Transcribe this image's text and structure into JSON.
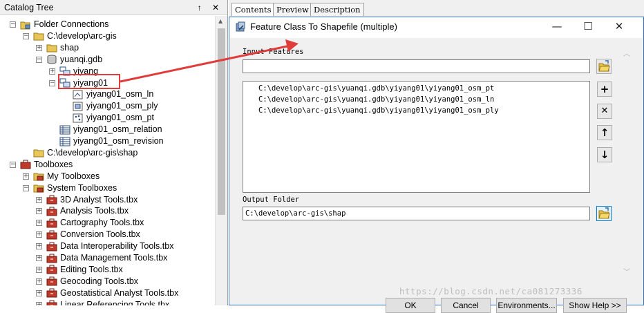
{
  "catalog": {
    "title": "Catalog Tree",
    "title_buttons": "↑ ✕",
    "tree": [
      {
        "label": "Folder Connections",
        "depth": 0,
        "exp": "−",
        "icon": "folder-connection-icon"
      },
      {
        "label": "C:\\develop\\arc-gis",
        "depth": 1,
        "exp": "−",
        "icon": "folder-icon"
      },
      {
        "label": "shap",
        "depth": 2,
        "exp": "+",
        "icon": "folder-icon"
      },
      {
        "label": "yuanqi.gdb",
        "depth": 2,
        "exp": "−",
        "icon": "geodatabase-icon"
      },
      {
        "label": "yiyang",
        "depth": 3,
        "exp": "+",
        "icon": "feature-dataset-icon"
      },
      {
        "label": "yiyang01",
        "depth": 3,
        "exp": "−",
        "icon": "feature-dataset-icon"
      },
      {
        "label": "yiyang01_osm_ln",
        "depth": 4,
        "exp": "",
        "icon": "line-feature-class-icon"
      },
      {
        "label": "yiyang01_osm_ply",
        "depth": 4,
        "exp": "",
        "icon": "polygon-feature-class-icon"
      },
      {
        "label": "yiyang01_osm_pt",
        "depth": 4,
        "exp": "",
        "icon": "point-feature-class-icon"
      },
      {
        "label": "yiyang01_osm_relation",
        "depth": 3,
        "exp": "",
        "icon": "table-icon"
      },
      {
        "label": "yiyang01_osm_revision",
        "depth": 3,
        "exp": "",
        "icon": "table-icon"
      },
      {
        "label": "C:\\develop\\arc-gis\\shap",
        "depth": 1,
        "exp": "",
        "icon": "folder-icon"
      },
      {
        "label": "Toolboxes",
        "depth": 0,
        "exp": "−",
        "icon": "toolboxes-icon"
      },
      {
        "label": "My Toolboxes",
        "depth": 1,
        "exp": "+",
        "icon": "toolbox-folder-icon"
      },
      {
        "label": "System Toolboxes",
        "depth": 1,
        "exp": "−",
        "icon": "toolbox-folder-icon"
      },
      {
        "label": "3D Analyst Tools.tbx",
        "depth": 2,
        "exp": "+",
        "icon": "toolbox-icon"
      },
      {
        "label": "Analysis Tools.tbx",
        "depth": 2,
        "exp": "+",
        "icon": "toolbox-icon"
      },
      {
        "label": "Cartography Tools.tbx",
        "depth": 2,
        "exp": "+",
        "icon": "toolbox-icon"
      },
      {
        "label": "Conversion Tools.tbx",
        "depth": 2,
        "exp": "+",
        "icon": "toolbox-icon"
      },
      {
        "label": "Data Interoperability Tools.tbx",
        "depth": 2,
        "exp": "+",
        "icon": "toolbox-icon"
      },
      {
        "label": "Data Management Tools.tbx",
        "depth": 2,
        "exp": "+",
        "icon": "toolbox-icon"
      },
      {
        "label": "Editing Tools.tbx",
        "depth": 2,
        "exp": "+",
        "icon": "toolbox-icon"
      },
      {
        "label": "Geocoding Tools.tbx",
        "depth": 2,
        "exp": "+",
        "icon": "toolbox-icon"
      },
      {
        "label": "Geostatistical Analyst Tools.tbx",
        "depth": 2,
        "exp": "+",
        "icon": "toolbox-icon"
      },
      {
        "label": "Linear Referencing Tools.tbx",
        "depth": 2,
        "exp": "+",
        "icon": "toolbox-icon"
      }
    ]
  },
  "tabs": [
    "Contents",
    "Preview",
    "Description"
  ],
  "dialog": {
    "title": "Feature Class To Shapefile (multiple)",
    "controls": {
      "minimize": "—",
      "maximize": "☐",
      "close": "✕"
    },
    "input_label": "Input Features",
    "input_value": "",
    "list_items": [
      "C:\\develop\\arc-gis\\yuanqi.gdb\\yiyang01\\yiyang01_osm_pt",
      "C:\\develop\\arc-gis\\yuanqi.gdb\\yiyang01\\yiyang01_osm_ln",
      "C:\\develop\\arc-gis\\yuanqi.gdb\\yiyang01\\yiyang01_osm_ply"
    ],
    "side_buttons": {
      "add": "+",
      "remove": "✕",
      "up": "↑",
      "down": "↓"
    },
    "output_label": "Output Folder",
    "output_value": "C:\\develop\\arc-gis\\shap",
    "buttons": {
      "ok": "OK",
      "cancel": "Cancel",
      "environments": "Environments...",
      "show_help": "Show Help >>"
    }
  },
  "watermark": "https://blog.csdn.net/ca081273336",
  "colors": {
    "annotation": "#e03c3c",
    "accent": "#0078d7"
  }
}
